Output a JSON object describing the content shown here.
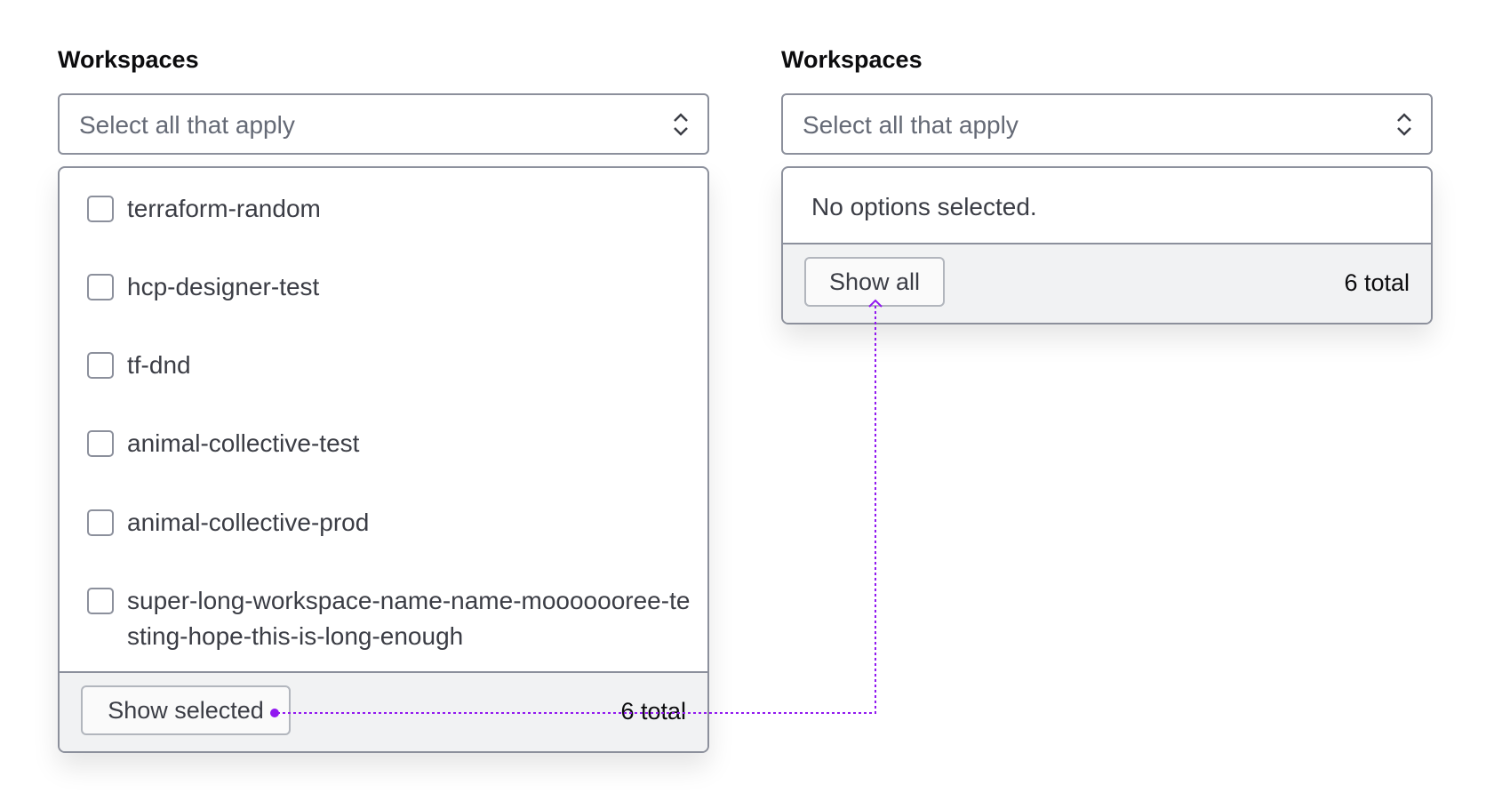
{
  "left": {
    "label": "Workspaces",
    "placeholder": "Select all that apply",
    "options": [
      "terraform-random",
      "hcp-designer-test",
      "tf-dnd",
      "animal-collective-test",
      "animal-collective-prod",
      "super-long-workspace-name-name-mooooooree-testing-hope-this-is-long-enough"
    ],
    "footer_button": "Show selected",
    "total": "6 total"
  },
  "right": {
    "label": "Workspaces",
    "placeholder": "Select all that apply",
    "empty_message": "No options selected.",
    "footer_button": "Show all",
    "total": "6 total"
  },
  "colors": {
    "connector": "#9118f0",
    "border": "#8c909c",
    "footer_bg": "#f1f2f3"
  },
  "icons": {
    "select_chevron": "chevron-up-down-icon"
  }
}
